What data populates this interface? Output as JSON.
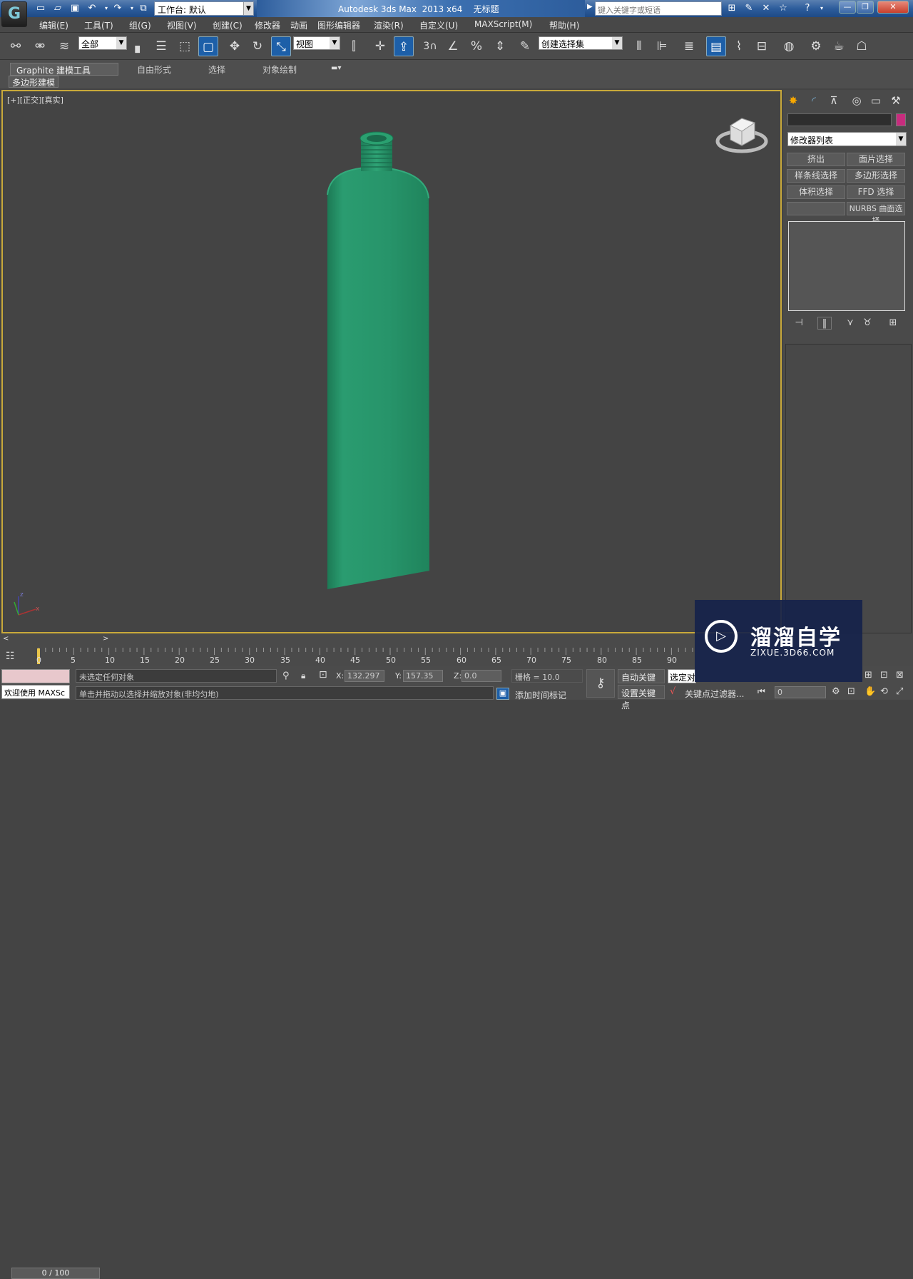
{
  "titlebar": {
    "app_title": "Autodesk 3ds Max  2013 x64",
    "doc_title": "无标题",
    "workspace_label": "工作台: 默认",
    "search_placeholder": "键入关键字或短语"
  },
  "menu": [
    "编辑(E)",
    "工具(T)",
    "组(G)",
    "视图(V)",
    "创建(C)",
    "修改器",
    "动画",
    "图形编辑器",
    "渲染(R)",
    "自定义(U)",
    "MAXScript(M)",
    "帮助(H)"
  ],
  "toolbar": {
    "selection_filter": "全部",
    "reference_coord": "视图",
    "named_selection": "创建选择集",
    "snap_label": "3"
  },
  "ribbon": {
    "tabs": [
      "Graphite 建模工具",
      "自由形式",
      "选择",
      "对象绘制"
    ],
    "subtab": "多边形建模"
  },
  "viewport": {
    "label": "[+][正交][真实]",
    "object_color": "#25966a",
    "background_color": "#444444",
    "border_color": "#c9a93a"
  },
  "command_panel": {
    "modifier_list": "修改器列表",
    "modifier_buttons": [
      "挤出",
      "面片选择",
      "样条线选择",
      "多边形选择",
      "体积选择",
      "FFD 选择",
      "",
      "NURBS 曲面选择"
    ],
    "object_color": "#c82c7e"
  },
  "timeline": {
    "slider_label": "0 / 100",
    "ticks": [
      "0",
      "5",
      "10",
      "15",
      "20",
      "25",
      "30",
      "35",
      "40",
      "45",
      "50",
      "55",
      "60",
      "65",
      "70",
      "75",
      "80",
      "85",
      "90"
    ]
  },
  "status": {
    "maxscript_label": "欢迎使用 MAXSc",
    "selection_status": "未选定任何对象",
    "prompt": "单击并拖动以选择并缩放对象(非均匀地)",
    "x_label": "X:",
    "x_value": "132.297",
    "y_label": "Y:",
    "y_value": "157.35",
    "z_label": "Z:",
    "z_value": "0.0",
    "grid": "栅格 = 10.0",
    "add_time_tag": "添加时间标记",
    "auto_key": "自动关键点",
    "set_key": "设置关键点",
    "selected_dropdown": "选定对",
    "key_filters": "关键点过滤器...",
    "frame_value": "0"
  },
  "watermark": {
    "title": "溜溜自学",
    "url": "ZIXUE.3D66.COM"
  }
}
